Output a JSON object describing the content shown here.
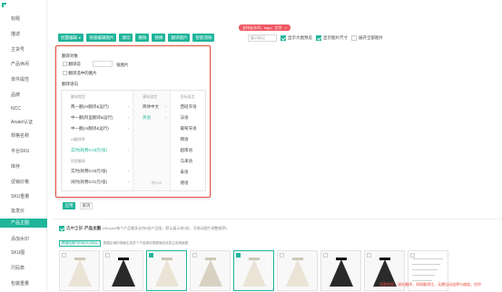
{
  "sidebar": {
    "items": [
      {
        "label": "标题"
      },
      {
        "label": "描述"
      },
      {
        "label": "主货号"
      },
      {
        "label": "产品休闲"
      },
      {
        "label": "单件属性"
      },
      {
        "label": "品牌"
      },
      {
        "label": "NCC"
      },
      {
        "label": "Anatel认证"
      },
      {
        "label": "规格名称"
      },
      {
        "label": "平台SKU"
      },
      {
        "label": "库存"
      },
      {
        "label": "促销价格"
      },
      {
        "label": "SKU重量"
      },
      {
        "label": "批发价"
      },
      {
        "label": "产品主图"
      },
      {
        "label": "添加水印"
      },
      {
        "label": "SKU图"
      },
      {
        "label": "尺码表"
      },
      {
        "label": "包装重量"
      }
    ],
    "active_index": 14
  },
  "toolbar": {
    "buttons": [
      {
        "label": "批量编辑",
        "has_caret": true
      },
      {
        "label": "快速编辑图片"
      },
      {
        "label": "裁切"
      },
      {
        "label": "删除"
      },
      {
        "label": "替换"
      },
      {
        "label": "翻译图片"
      },
      {
        "label": "智能消除"
      }
    ],
    "tip_badge": "支持去水印、logo、文字",
    "tip_close": "×",
    "select_placeholder": "展示标记",
    "checkboxes": [
      {
        "label": "显示大图预览",
        "checked": true
      },
      {
        "label": "显示图片尺寸",
        "checked": true
      },
      {
        "label": "展开全部图片",
        "checked": false
      }
    ]
  },
  "panel": {
    "target_title": "翻译对象",
    "option_first_n": "翻译前",
    "option_first_n_value": "",
    "option_first_n_suffix": "张图片",
    "option_all": "翻译选中的图片",
    "direction_title": "翻译语向",
    "cascader": {
      "col1": {
        "header": "翻译类型",
        "items": [
          {
            "label": "两一翻(AI翻译&运行)",
            "arrow": true
          },
          {
            "label": "中一翻(阿里翻译&运行)",
            "arrow": true
          },
          {
            "label": "中一翻(AI翻译&运行)",
            "arrow": true
          },
          {
            "label": "AI翻译率",
            "arrow": false,
            "sub": true
          },
          {
            "label": "实时(耗费0.03元/张)",
            "arrow": true,
            "selected": true
          },
          {
            "label": "阿里翻译",
            "arrow": false,
            "sub": true
          },
          {
            "label": "实时(耗费0.03元/张)",
            "arrow": true
          },
          {
            "label": "闲时(耗费0.01元/张)",
            "arrow": true
          }
        ]
      },
      "col2": {
        "header": "源站语言",
        "items": [
          {
            "label": "简体中文",
            "arrow": true
          },
          {
            "label": "英语",
            "arrow": true,
            "selected": true
          }
        ],
        "count": "约719"
      },
      "col3": {
        "header": "目标语言",
        "items": [
          {
            "label": "西班牙语"
          },
          {
            "label": "法语"
          },
          {
            "label": "葡萄牙语"
          },
          {
            "label": "韩语"
          },
          {
            "label": "越南语"
          },
          {
            "label": "马来语"
          },
          {
            "label": "泰语"
          },
          {
            "label": "德语"
          }
        ]
      }
    },
    "apply_label": "应用",
    "cancel_label": "取消"
  },
  "product_section": {
    "select_all": "选中全部",
    "title": "产品主图",
    "description": "(Shopee每个产品最多支持9张产品图，默认展示前9张，可拖动图片调整顺序)",
    "info_tag": "跨境电商PSDNIGLOBAL",
    "info_text": "根据店铺的规格生成多个子品牌并根据商品信息生成规格图",
    "thumbs": [
      {
        "style": "light",
        "selected": false
      },
      {
        "style": "dark",
        "selected": false
      },
      {
        "style": "light",
        "selected": true
      },
      {
        "style": "mix",
        "selected": false
      },
      {
        "style": "light",
        "selected": true
      },
      {
        "style": "light",
        "selected": false
      },
      {
        "style": "dark",
        "selected": false
      },
      {
        "style": "dark",
        "selected": false
      },
      {
        "style": "doc",
        "selected": false
      }
    ],
    "red_note": "如要转图，请先翻译，再按翻译比，无需自动选择与缩放，任你"
  },
  "colors": {
    "accent": "#1fb59a",
    "alert": "#e94b3c",
    "badge": "#f05a64"
  }
}
